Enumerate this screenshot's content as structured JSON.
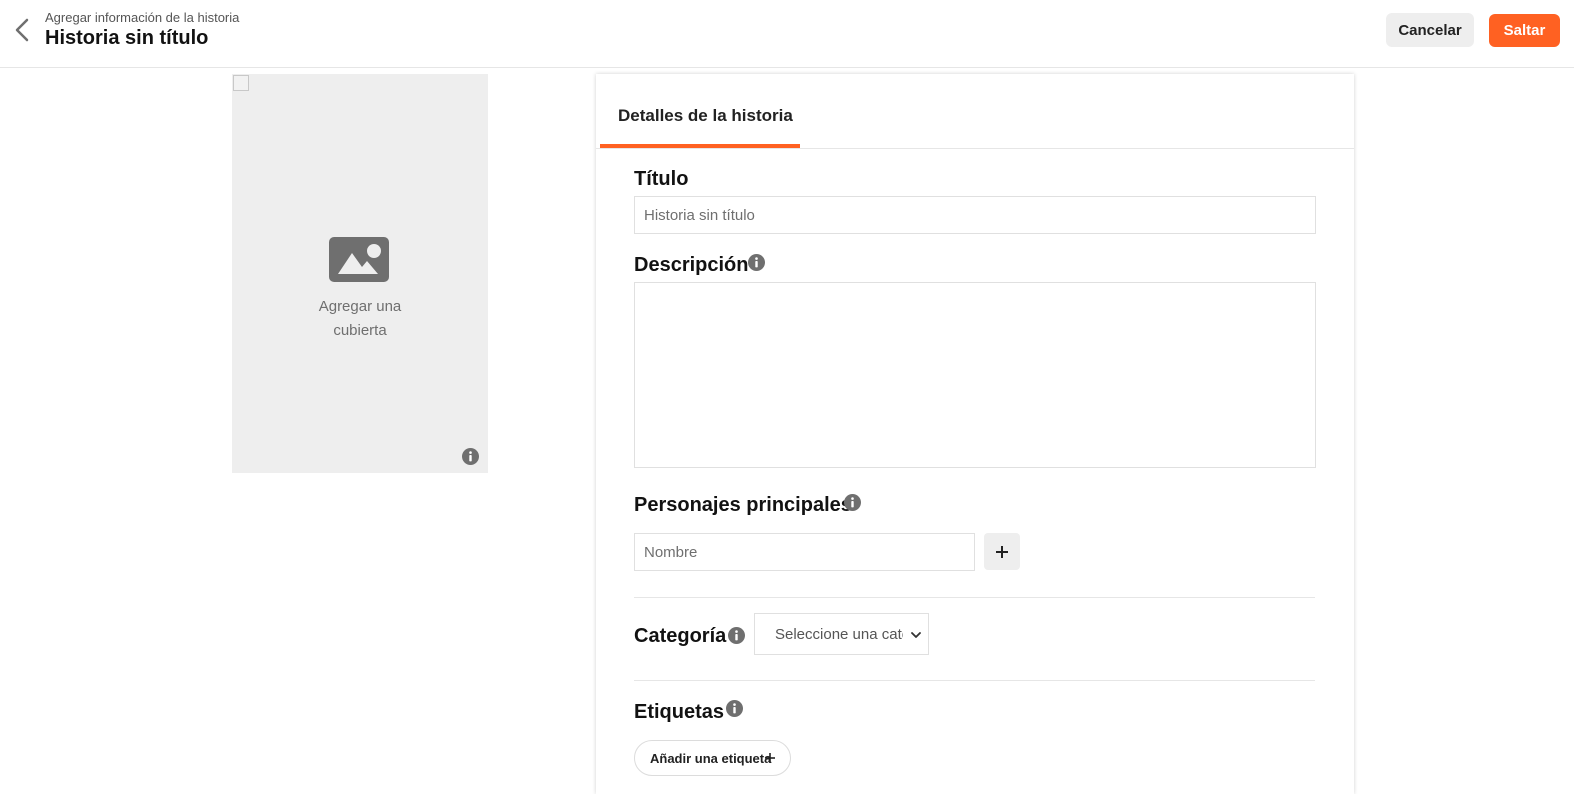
{
  "header": {
    "subtitle": "Agregar información de la historia",
    "title": "Historia sin título",
    "cancel_label": "Cancelar",
    "skip_label": "Saltar",
    "back_icon": "chevron-left-icon"
  },
  "cover": {
    "label": "Agregar una\ncubierta",
    "icon": "image-icon",
    "info_icon": "info-icon"
  },
  "details": {
    "tab_label": "Detalles de la historia",
    "title_label": "Título",
    "title_placeholder": "Historia sin título",
    "description_label": "Descripción",
    "description_value": "",
    "characters_label": "Personajes principales",
    "character_placeholder": "Nombre",
    "category_label": "Categoría",
    "category_selected": "Seleccione una categoría",
    "tags_label": "Etiquetas",
    "add_tag_label": "Añadir una etiqueta"
  },
  "colors": {
    "accent": "#ff6122",
    "button_gray": "#eeeeee",
    "border": "#e0e0e0",
    "icon_gray": "#6f6f6f"
  }
}
